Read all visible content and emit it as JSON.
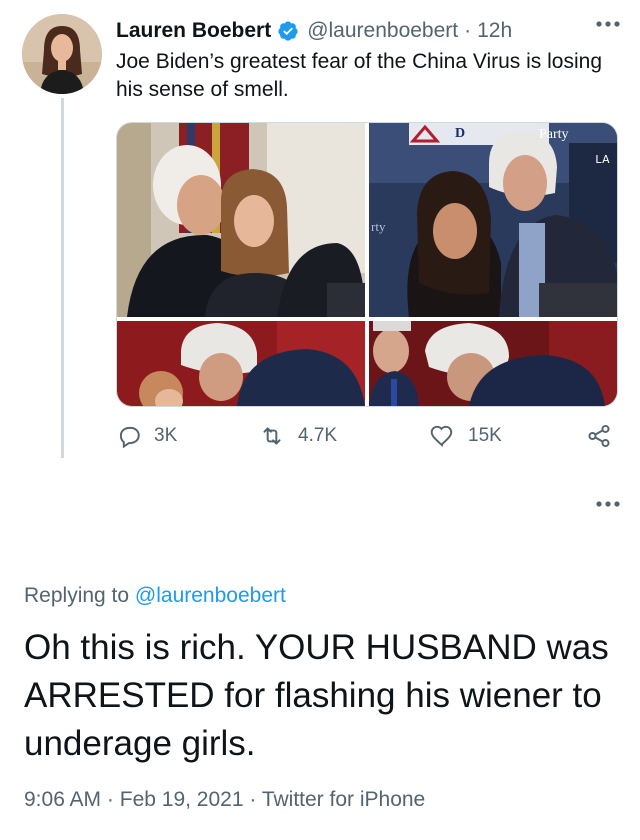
{
  "tweet": {
    "author_name": "Lauren Boebert",
    "handle": "@laurenboebert",
    "separator": "·",
    "time": "12h",
    "text": "Joe Biden’s greatest fear of the China Virus is losing his sense of smell.",
    "media_signs": {
      "party_sign": "Party",
      "la_text": "LA",
      "rty_text": "rty",
      "d_text": "D"
    },
    "actions": {
      "replies": "3K",
      "retweets": "4.7K",
      "likes": "15K"
    }
  },
  "reply": {
    "replying_to_prefix": "Replying to",
    "replying_to_handle": "@laurenboebert",
    "text": "Oh this is rich. YOUR HUSBAND was ARRESTED for flashing his wiener to underage girls.",
    "time": "9:06 AM",
    "date": "Feb 19, 2021",
    "client": "Twitter for iPhone",
    "separator": "·"
  },
  "icons": {
    "verified": "verified-badge-icon",
    "more": "more-horizontal-icon",
    "reply": "reply-icon",
    "retweet": "retweet-icon",
    "like": "heart-icon",
    "share": "share-icon"
  },
  "colors": {
    "accent_blue": "#1d9bf0",
    "text_primary": "#0f1419",
    "text_secondary": "#536471",
    "thread_line": "#cfd9de"
  }
}
